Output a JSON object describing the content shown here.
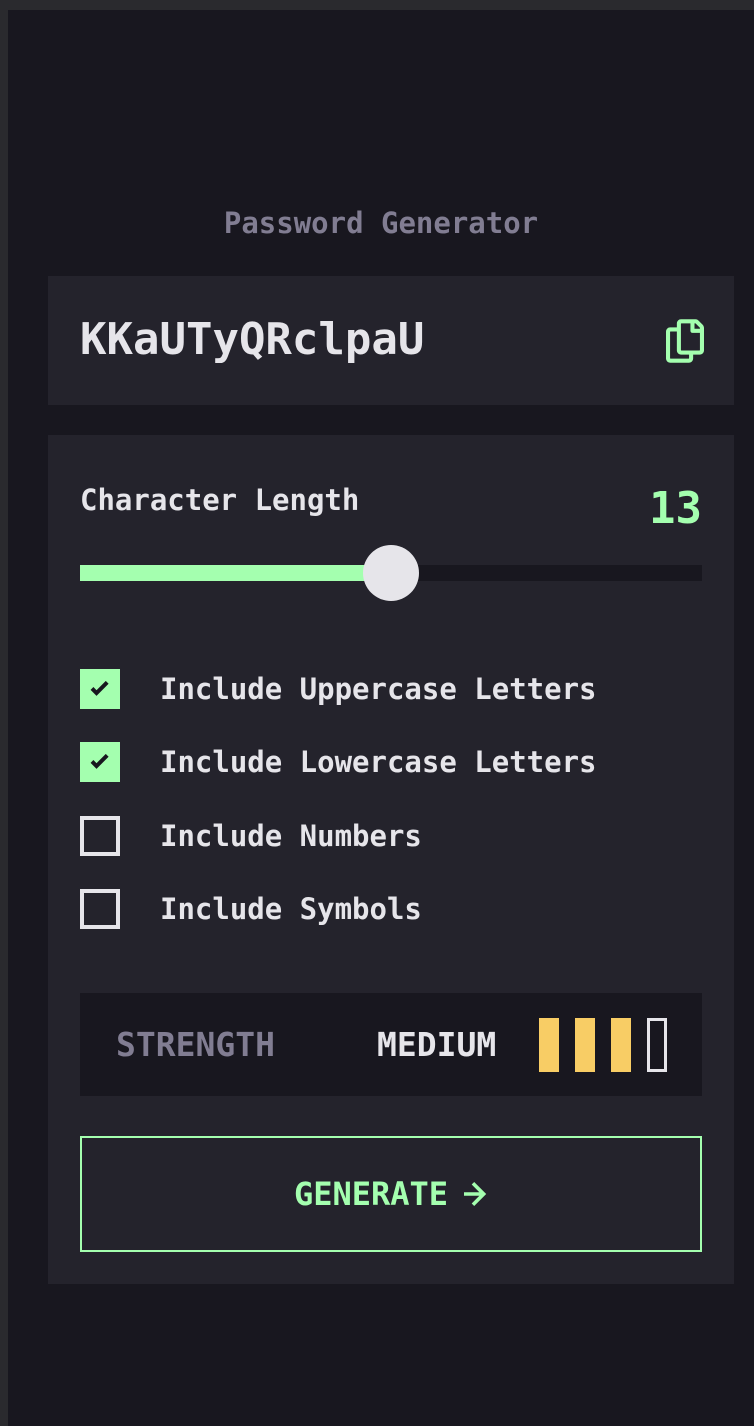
{
  "app": {
    "title": "Password Generator"
  },
  "output": {
    "password": "KKaUTyQRclpaU",
    "copy_icon": "copy-icon"
  },
  "length": {
    "label": "Character Length",
    "value": "13",
    "slider_fraction": 0.5
  },
  "options": [
    {
      "label": "Include Uppercase Letters",
      "checked": true
    },
    {
      "label": "Include Lowercase Letters",
      "checked": true
    },
    {
      "label": "Include Numbers",
      "checked": false
    },
    {
      "label": "Include Symbols",
      "checked": false
    }
  ],
  "strength": {
    "label": "STRENGTH",
    "value": "MEDIUM",
    "bars_filled": 3,
    "bars_total": 4
  },
  "generate": {
    "label": "GENERATE"
  },
  "colors": {
    "background": "#18171f",
    "card": "#24232c",
    "accent": "#a4ffaf",
    "text": "#e6e5ea",
    "muted": "#817d92",
    "strength_medium": "#f8cd65"
  }
}
